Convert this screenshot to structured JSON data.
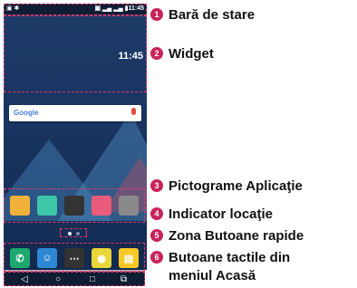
{
  "phone": {
    "statusbar": {
      "left_icons": "▣ ✱",
      "right_text": "▣ ▂▄ ▂▄ ▮11:45"
    },
    "widget": {
      "time": "11:45"
    },
    "search": {
      "logo": "Google"
    },
    "apps": [
      {
        "name": "lg-health-icon",
        "color": "#f2b13a"
      },
      {
        "name": "play-store-icon",
        "color": "#3ec6a8"
      },
      {
        "name": "camera-icon",
        "color": "#333333"
      },
      {
        "name": "gallery-icon",
        "color": "#eb5b7b"
      },
      {
        "name": "app-drawer-icon",
        "color": "#8a8a8a"
      }
    ],
    "quick": [
      {
        "name": "phone-icon",
        "color": "#1ca86e"
      },
      {
        "name": "contacts-icon",
        "color": "#2e87d4"
      },
      {
        "name": "apps-icon",
        "color": "#333333"
      },
      {
        "name": "chrome-icon",
        "color": "#e9d63a"
      },
      {
        "name": "messages-icon",
        "color": "#f7c829"
      }
    ],
    "softkeys": [
      "◁",
      "○",
      "□",
      "⧉"
    ]
  },
  "callouts": [
    {
      "num": "1",
      "label": "Bară de stare"
    },
    {
      "num": "2",
      "label": "Widget"
    },
    {
      "num": "3",
      "label": "Pictograme Aplicaţie"
    },
    {
      "num": "4",
      "label": "Indicator locaţie"
    },
    {
      "num": "5",
      "label": "Zona Butoane rapide"
    },
    {
      "num": "6",
      "label": "Butoane tactile din"
    },
    {
      "num": "",
      "label": "meniul Acasă"
    }
  ],
  "accent": "#c8235a"
}
